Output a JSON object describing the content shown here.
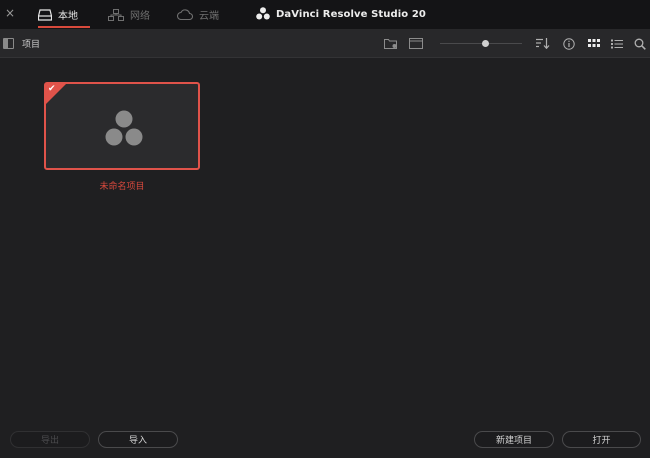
{
  "window": {
    "close_symbol": "×",
    "brand_title": "DaVinci Resolve Studio 20"
  },
  "tabs": [
    {
      "label": "本地",
      "icon": "drive-icon",
      "active": true
    },
    {
      "label": "网络",
      "icon": "network-icon",
      "active": false
    },
    {
      "label": "云端",
      "icon": "cloud-icon",
      "active": false
    }
  ],
  "toolbar": {
    "breadcrumb": "项目",
    "icons": [
      "new-folder-icon",
      "window-icon",
      "sort-icon",
      "info-icon",
      "grid-view-icon",
      "list-view-icon",
      "search-icon"
    ],
    "thumbnail_zoom": 0.55
  },
  "projects": [
    {
      "name": "未命名项目",
      "selected": true
    }
  ],
  "buttons": {
    "export": "导出",
    "import": "导入",
    "new_project": "新建项目",
    "open": "打开"
  },
  "colors": {
    "accent": "#e0534a",
    "topbar": "#141416",
    "toolbar": "#28282a",
    "background": "#1f1f21"
  }
}
